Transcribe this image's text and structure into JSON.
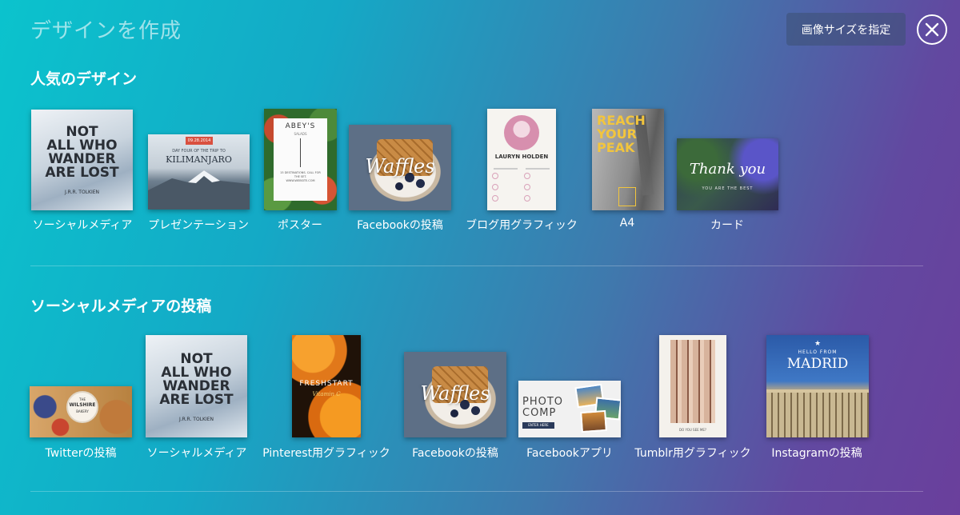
{
  "header": {
    "title": "デザインを作成",
    "custom_size_label": "画像サイズを指定"
  },
  "popular": {
    "title": "人気のデザイン",
    "items": [
      {
        "label": "ソーシャルメディア",
        "thumb": {
          "line1": "NOT",
          "line2": "ALL WHO",
          "line3": "WANDER",
          "line4": "ARE LOST",
          "author": "J.R.R. TOLKIEN"
        }
      },
      {
        "label": "プレゼンテーション",
        "thumb": {
          "date": "09.28.2014",
          "sub": "DAY FOUR OF THE TRIP TO",
          "main": "KILIMANJARO"
        }
      },
      {
        "label": "ポスター",
        "thumb": {
          "name": "ABEY'S",
          "sub": "SALADS",
          "text": "15 DESTINATIONS. CALL FOR THE SET. WWW.WEBSITE.COM"
        }
      },
      {
        "label": "Facebookの投稿",
        "thumb": {
          "script": "Waffles"
        }
      },
      {
        "label": "ブログ用グラフィック",
        "thumb": {
          "name": "LAURYN HOLDEN"
        }
      },
      {
        "label": "A4",
        "thumb": {
          "line1": "REACH",
          "line2": "YOUR",
          "line3": "PEAK"
        }
      },
      {
        "label": "カード",
        "thumb": {
          "script": "Thank you",
          "sub": "YOU ARE THE BEST"
        }
      }
    ]
  },
  "social": {
    "title": "ソーシャルメディアの投稿",
    "items": [
      {
        "label": "Twitterの投稿",
        "thumb": {
          "small": "THE",
          "name": "WILSHIRE",
          "sub": "BAKERY"
        }
      },
      {
        "label": "ソーシャルメディア",
        "thumb": {
          "line1": "NOT",
          "line2": "ALL WHO",
          "line3": "WANDER",
          "line4": "ARE LOST",
          "author": "J.R.R. TOLKIEN"
        }
      },
      {
        "label": "Pinterest用グラフィック",
        "thumb": {
          "main": "FRESHSTART",
          "sub": "Vitamin C"
        }
      },
      {
        "label": "Facebookの投稿",
        "thumb": {
          "script": "Waffles"
        }
      },
      {
        "label": "Facebookアプリ",
        "thumb": {
          "line1": "PHOTO",
          "line2": "COMP",
          "btn": "ENTER HERE"
        }
      },
      {
        "label": "Tumblr用グラフィック",
        "thumb": {
          "sub": "DO YOU SEE ME?"
        }
      },
      {
        "label": "Instagramの投稿",
        "thumb": {
          "small": "HELLO FROM",
          "main": "MADRID"
        }
      }
    ]
  },
  "colors": {
    "gradient_start": "#0bc3cd",
    "gradient_end": "#6a3f9c",
    "reach_yellow": "#f2c53d",
    "date_red": "#d9503f"
  }
}
